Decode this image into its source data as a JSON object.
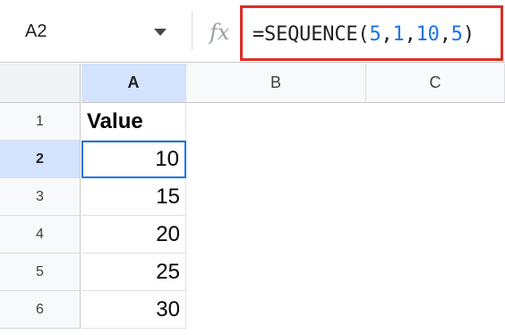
{
  "name_box": {
    "value": "A2"
  },
  "formula_bar": {
    "fx_icon": "fx",
    "formula_parts": [
      "=SEQUENCE(",
      "5",
      ",",
      "1",
      ",",
      "10",
      ",",
      "5",
      ")"
    ]
  },
  "columns": [
    "A",
    "B",
    "C"
  ],
  "rows": [
    "1",
    "2",
    "3",
    "4",
    "5",
    "6"
  ],
  "cells": {
    "A1": "Value",
    "A2": "10",
    "A3": "15",
    "A4": "20",
    "A5": "25",
    "A6": "30"
  },
  "colors": {
    "highlight_border": "#d93025",
    "selection_blue": "#1a73e8",
    "header_selected": "#d3e3fd"
  }
}
